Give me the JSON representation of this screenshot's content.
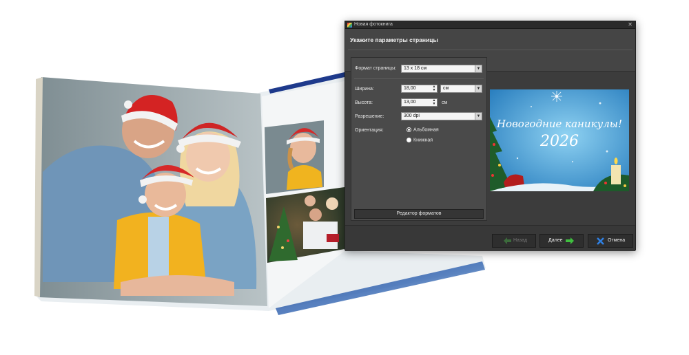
{
  "dialog": {
    "window_title": "Новая фотокнига",
    "heading": "Укажите параметры страницы",
    "fields": {
      "format_label": "Формат страницы:",
      "format_value": "13 x 18 см",
      "width_label": "Ширина:",
      "width_value": "18,00",
      "width_unit": "см",
      "height_label": "Высота:",
      "height_value": "13,00",
      "height_unit": "см",
      "resolution_label": "Разрешение:",
      "resolution_value": "300 dpi",
      "orientation_label": "Ориентация:",
      "orientation_options": [
        "Альбомная",
        "Книжная"
      ],
      "orientation_selected": "Альбомная"
    },
    "format_editor_button": "Редактор форматов",
    "preview": {
      "line1": "Новогодние каникулы!",
      "line2": "2026",
      "background_color": "#3a8fc8"
    },
    "buttons": {
      "back": "Назад",
      "next": "Далее",
      "cancel": "Отмена"
    },
    "colors": {
      "accent_green": "#3fbf3f",
      "cancel_blue": "#2f7fe0"
    }
  }
}
